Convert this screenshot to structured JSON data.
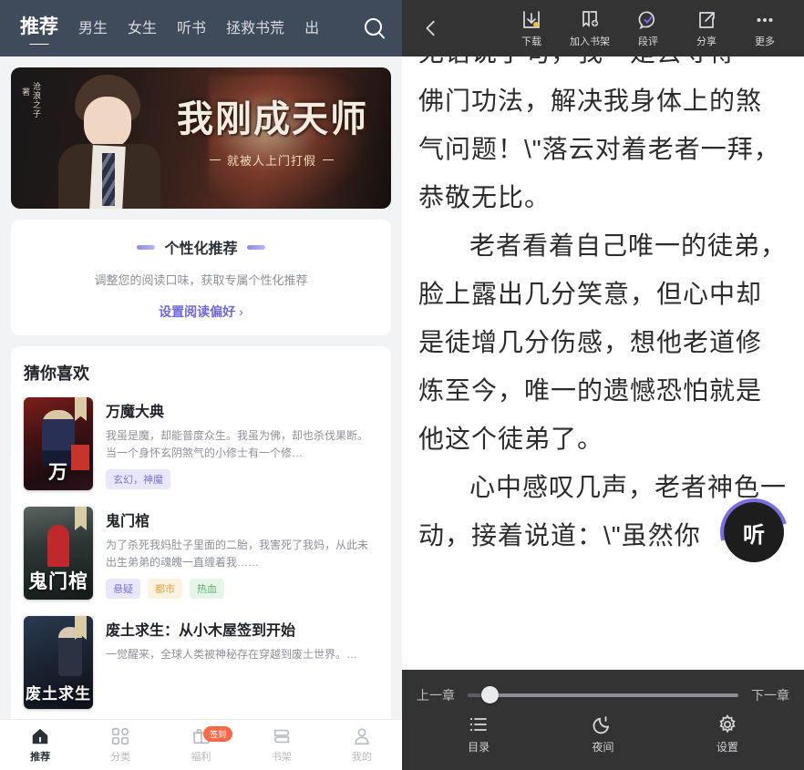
{
  "left": {
    "nav": {
      "tabs": [
        {
          "label": "推荐",
          "active": true
        },
        {
          "label": "男生",
          "active": false
        },
        {
          "label": "女生",
          "active": false
        },
        {
          "label": "听书",
          "active": false
        },
        {
          "label": "拯救书荒",
          "active": false
        },
        {
          "label": "出",
          "active": false
        }
      ],
      "search_icon": "search-icon"
    },
    "banner": {
      "author": "沧浪之子",
      "byline": "著",
      "title": "我刚成天师",
      "subtitle": "就被人上门打假"
    },
    "personalized": {
      "title": "个性化推荐",
      "subtitle": "调整您的阅读口味，获取专属个性化推荐",
      "link": "设置阅读偏好",
      "chevron": "›"
    },
    "guess": {
      "heading": "猜你喜欢",
      "books": [
        {
          "title": "万魔大典",
          "cover_text": "万",
          "desc": "我虽是魔，却能普度众生。我虽为佛，却也杀伐果断。当一个身怀玄阴煞气的小修士有一个修…",
          "tags": [
            {
              "label": "玄幻，神魔",
              "color": "purple"
            }
          ]
        },
        {
          "title": "鬼门棺",
          "cover_text": "鬼门棺",
          "desc": "为了杀死我妈肚子里面的二胎，我害死了我妈，从此未出生弟弟的魂魄一直缠着我……",
          "tags": [
            {
              "label": "悬疑",
              "color": "purple"
            },
            {
              "label": "都市",
              "color": "orange"
            },
            {
              "label": "热血",
              "color": "green"
            }
          ]
        },
        {
          "title": "废土求生：从小木屋签到开始",
          "cover_text": "废土求生",
          "desc": "一觉醒来，全球人类被神秘存在穿越到废土世界。…",
          "tags": []
        }
      ]
    },
    "tabbar": {
      "items": [
        {
          "label": "推荐",
          "icon": "home-icon",
          "active": true,
          "badge": ""
        },
        {
          "label": "分类",
          "icon": "grid-icon",
          "active": false,
          "badge": ""
        },
        {
          "label": "福利",
          "icon": "gift-icon",
          "active": false,
          "badge": "签到"
        },
        {
          "label": "书架",
          "icon": "bookshelf-icon",
          "active": false,
          "badge": ""
        },
        {
          "label": "我的",
          "icon": "person-icon",
          "active": false,
          "badge": ""
        }
      ]
    }
  },
  "right": {
    "toolbar": {
      "back_icon": "chevron-left-icon",
      "actions": [
        {
          "label": "下载",
          "icon": "download-icon"
        },
        {
          "label": "加入书架",
          "icon": "add-bookshelf-icon"
        },
        {
          "label": "段评",
          "icon": "comment-icon"
        },
        {
          "label": "分享",
          "icon": "share-icon"
        },
        {
          "label": "更多",
          "icon": "more-icon"
        }
      ]
    },
    "reader": {
      "clipped_line": "无语说了句，我一是去寻得",
      "paragraphs": [
        "佛门功法，解决我身体上的煞气问题！\\\"落云对着老者一拜，恭敬无比。",
        "老者看着自己唯一的徒弟，脸上露出几分笑意，但心中却是徒增几分伤感，想他老道修炼至今，唯一的遗憾恐怕就是他这个徒弟了。",
        "心中感叹几声，老者神色一动，接着说道：\\\"虽然你"
      ],
      "listen_button": "听"
    },
    "controls": {
      "prev_chapter": "上一章",
      "next_chapter": "下一章",
      "progress_percent": 8,
      "actions": [
        {
          "label": "目录",
          "icon": "list-icon"
        },
        {
          "label": "夜间",
          "icon": "moon-icon"
        },
        {
          "label": "设置",
          "icon": "gear-icon"
        }
      ]
    }
  },
  "colors": {
    "nav_bg": "#3f4a5a",
    "reader_chrome": "#333333",
    "accent_purple": "#6f68e0",
    "badge_orange": "#fb6a47"
  }
}
